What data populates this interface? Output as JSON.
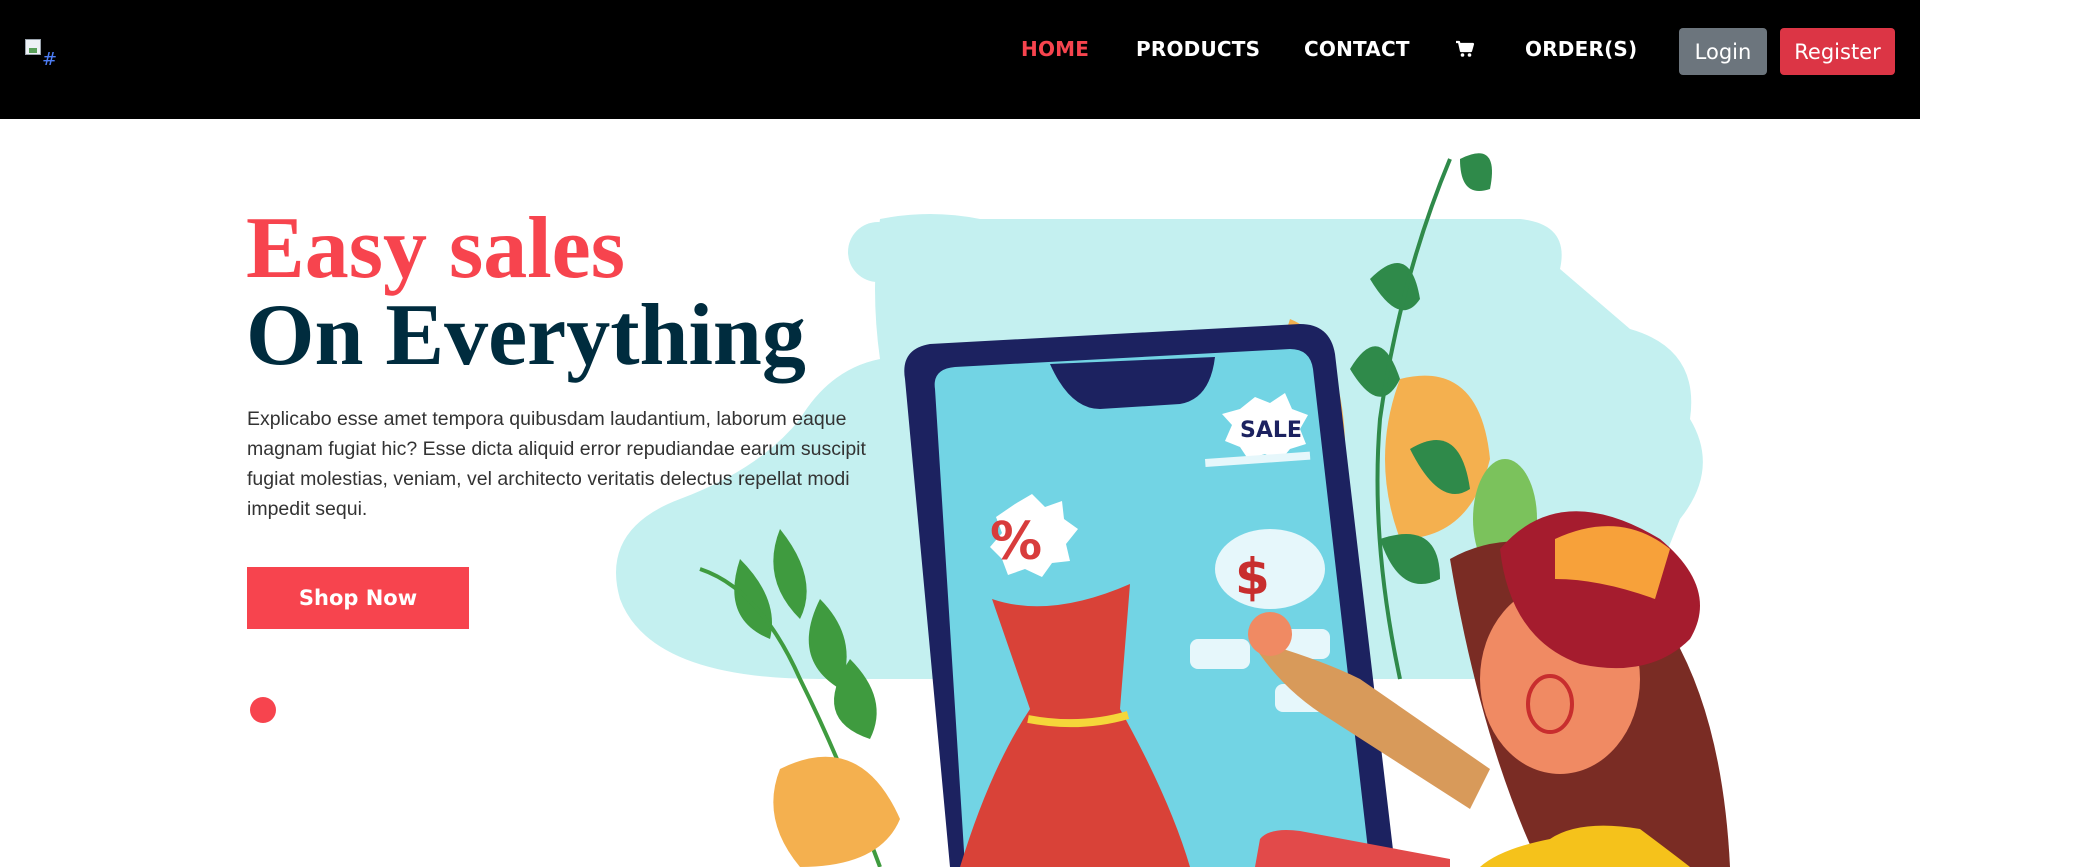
{
  "header": {
    "logo_alt": "#",
    "nav": {
      "home": "HOME",
      "products": "PRODUCTS",
      "contact": "CONTACT",
      "cart_icon": "cart-icon",
      "orders": "ORDER(S)"
    },
    "login_label": "Login",
    "register_label": "Register"
  },
  "hero": {
    "title_line1": "Easy sales",
    "title_line2": "On Everything",
    "description": "Explicabo esse amet tempora quibusdam laudantium, laborum eaque magnam fugiat hic? Esse dicta aliquid error repudiandae earum suscipit fugiat molestias, veniam, vel architecto veritatis delectus repellat modi impedit sequi.",
    "cta_label": "Shop Now",
    "illustration": {
      "sale_tag": "SALE",
      "percent_tag": "%",
      "dollar_tag": "$"
    }
  },
  "colors": {
    "navbar_bg": "#000000",
    "accent": "#f7444e",
    "title_dark": "#002c3e",
    "login_bg": "#6c757d",
    "register_bg": "#dc3545",
    "backdrop": "#c4f0f0"
  }
}
